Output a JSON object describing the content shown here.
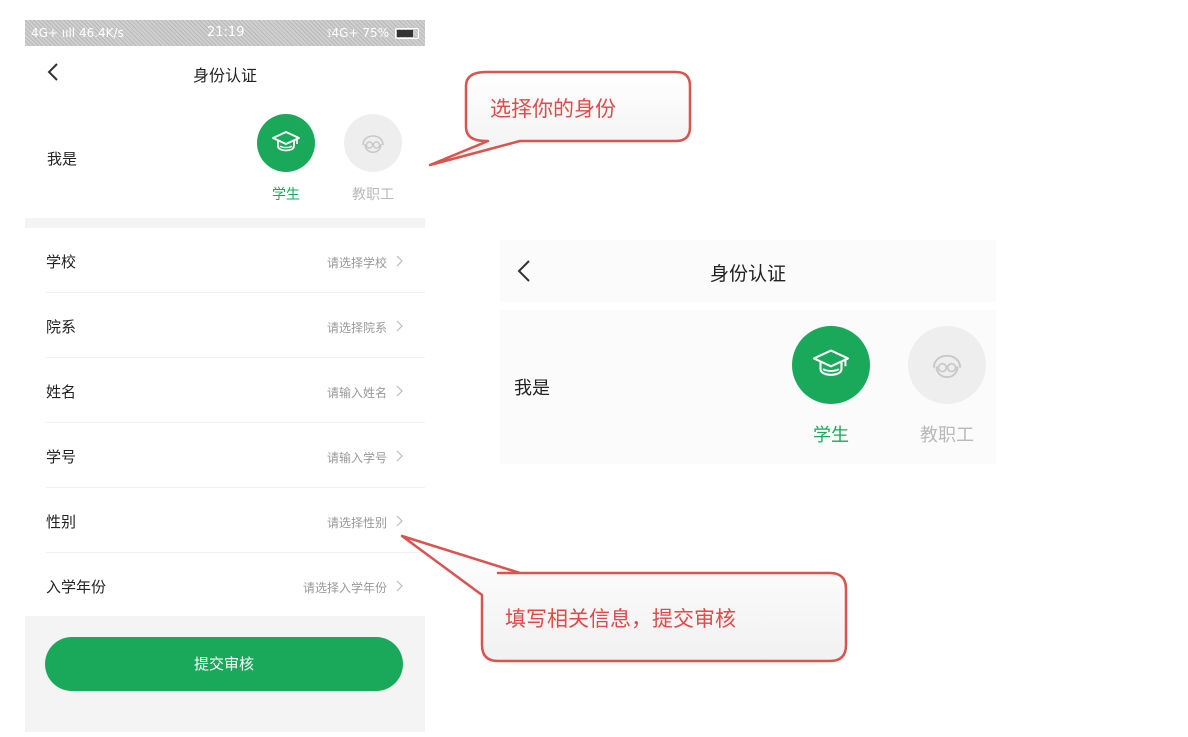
{
  "phone": {
    "status": {
      "left": "4G+ ııll 46.4K/s",
      "time": "21:19",
      "right": "⟟4G+ 75%"
    },
    "nav": {
      "title": "身份认证",
      "back_icon": "chevron-left-icon"
    },
    "identity": {
      "label": "我是",
      "roles": [
        {
          "name": "学生",
          "icon": "graduation-cap-icon",
          "selected": true
        },
        {
          "name": "教职工",
          "icon": "teacher-glasses-icon",
          "selected": false
        }
      ]
    },
    "form": {
      "rows": [
        {
          "label": "学校",
          "placeholder": "请选择学校"
        },
        {
          "label": "院系",
          "placeholder": "请选择院系"
        },
        {
          "label": "姓名",
          "placeholder": "请输入姓名"
        },
        {
          "label": "学号",
          "placeholder": "请输入学号"
        },
        {
          "label": "性别",
          "placeholder": "请选择性别"
        },
        {
          "label": "入学年份",
          "placeholder": "请选择入学年份"
        }
      ]
    },
    "submit_label": "提交审核"
  },
  "zoom": {
    "title": "身份认证",
    "label": "我是",
    "roles": [
      {
        "name": "学生",
        "selected": true
      },
      {
        "name": "教职工",
        "selected": false
      }
    ]
  },
  "callouts": [
    {
      "text": "选择你的身份"
    },
    {
      "text": "填写相关信息，提交审核"
    }
  ],
  "colors": {
    "accent": "#1aa85a",
    "callout": "#e04a4a",
    "muted": "#b9b9b9"
  }
}
